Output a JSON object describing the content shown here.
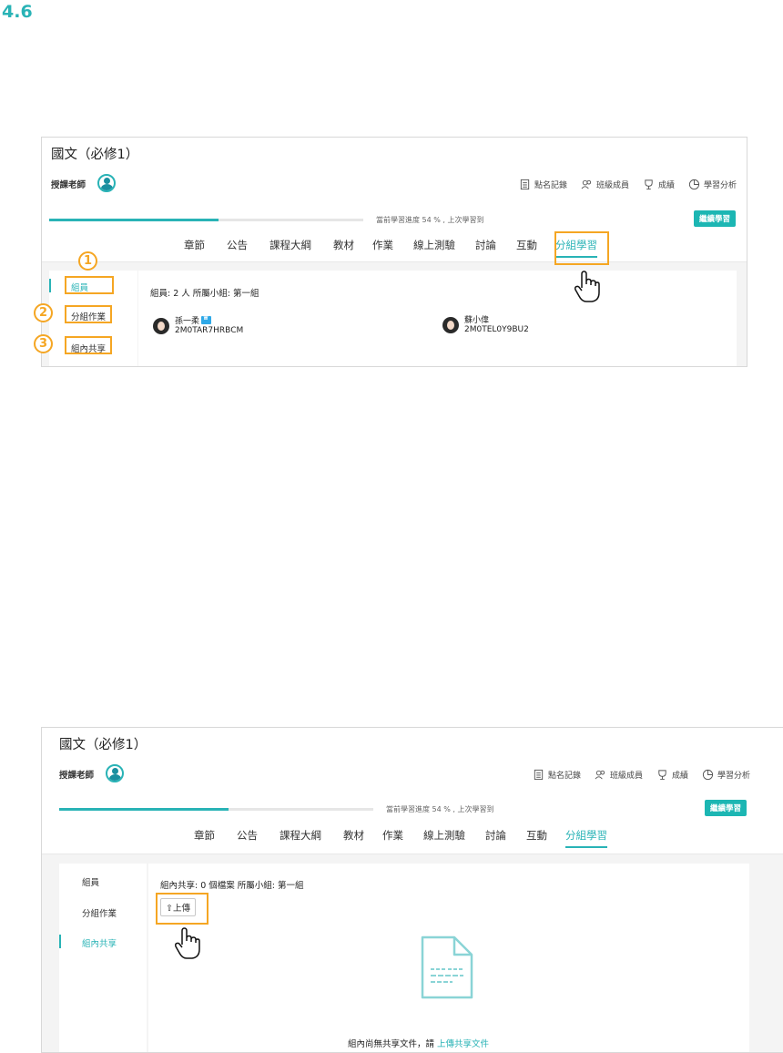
{
  "section_number": "4.6",
  "course": {
    "title": "國文（必修1）",
    "teacher_label": "授課老師"
  },
  "toolbar": [
    "點名記錄",
    "班級成員",
    "成績",
    "學習分析"
  ],
  "progress": {
    "percent": 54,
    "text": "當前學習進度 54 % , 上次學習到",
    "continue_label": "繼續學習"
  },
  "tabs": [
    "章節",
    "公告",
    "課程大綱",
    "教材",
    "作業",
    "線上測驗",
    "討論",
    "互動",
    "分組學習"
  ],
  "sidebar": [
    "組員",
    "分組作業",
    "組內共享"
  ],
  "callouts": [
    "1",
    "2",
    "3"
  ],
  "panel1": {
    "info": "組員:  2 人   所屬小組:  第一組",
    "members": [
      {
        "name": "孫一柔",
        "id": "2M0TAR7HRBCM",
        "leader": true
      },
      {
        "name": "蘇小偉",
        "id": "2M0TEL0Y9BU2",
        "leader": false
      }
    ]
  },
  "panel2": {
    "info": "組內共享:  0  個檔案   所屬小組:  第一組",
    "upload_label": "上傳",
    "empty_text": "組內尚無共享文件，請 ",
    "empty_link": "上傳共享文件"
  },
  "colors": {
    "accent": "#29b3b6",
    "highlight": "#f5a623"
  }
}
